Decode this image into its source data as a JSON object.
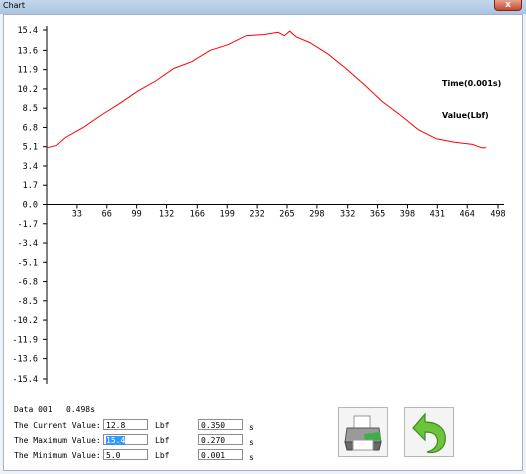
{
  "window": {
    "title": "Chart",
    "close_glyph": "x"
  },
  "chart_data": {
    "type": "line",
    "y_ticks": [
      "15.4",
      "13.6",
      "11.9",
      "10.2",
      "8.5",
      "6.8",
      "5.1",
      "3.4",
      "1.7",
      "0.0",
      "-1.7",
      "-3.4",
      "-5.1",
      "-6.8",
      "-8.5",
      "-10.2",
      "-11.9",
      "-13.6",
      "-15.4"
    ],
    "x_ticks": [
      "33",
      "66",
      "99",
      "132",
      "166",
      "199",
      "232",
      "265",
      "298",
      "332",
      "365",
      "398",
      "431",
      "464",
      "498"
    ],
    "ylim": [
      -15.4,
      15.4
    ],
    "xlim": [
      0,
      498
    ],
    "legend": [
      "Time(0.001s)",
      "Value(Lbf)"
    ],
    "series": [
      {
        "color": "#ff0000",
        "x": [
          0,
          10,
          20,
          40,
          60,
          80,
          100,
          120,
          140,
          160,
          180,
          200,
          220,
          240,
          255,
          262,
          268,
          275,
          290,
          310,
          330,
          350,
          370,
          390,
          410,
          430,
          450,
          470,
          480,
          485
        ],
        "y": [
          5.0,
          5.2,
          5.9,
          6.8,
          7.9,
          8.9,
          10.0,
          10.9,
          12.0,
          12.6,
          13.6,
          14.1,
          14.9,
          15.0,
          15.2,
          14.9,
          15.3,
          14.8,
          14.3,
          13.3,
          12.0,
          10.6,
          9.1,
          7.9,
          6.6,
          5.8,
          5.5,
          5.3,
          5.0,
          5.0
        ]
      }
    ]
  },
  "info": {
    "data_label": "Data 001",
    "time_value": "0.498s",
    "current_label": "The Current Value:",
    "current_value": "12.8",
    "current_unit": "Lbf",
    "current_time": "0.350",
    "current_time_unit": "s",
    "max_label": "The Maximum Value:",
    "max_value": "15.4",
    "max_unit": "Lbf",
    "max_time": "0.270",
    "max_time_unit": "s",
    "min_label": "The Minimum Value:",
    "min_value": "5.0",
    "min_unit": "Lbf",
    "min_time": "0.001",
    "min_time_unit": "s"
  },
  "buttons": {
    "print": "printer-icon",
    "back": "back-arrow-icon"
  },
  "colors": {
    "series": "#ff0000",
    "back_arrow": "#5cb82e",
    "printer_body": "#8a8a8a"
  }
}
